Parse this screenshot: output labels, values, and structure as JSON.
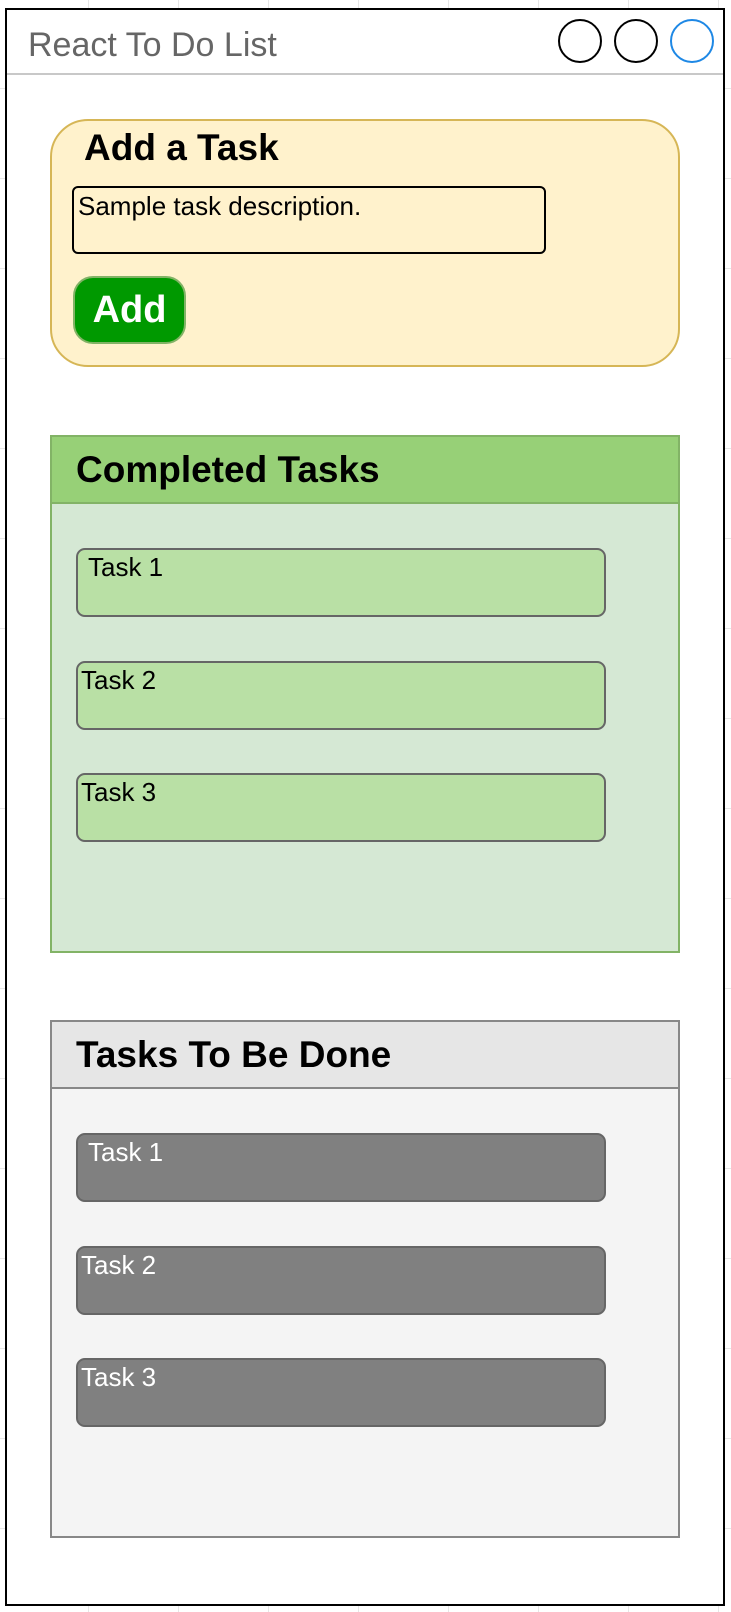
{
  "window": {
    "title": "React To Do List",
    "controls": [
      {
        "name": "window-control-1",
        "color": "#000000"
      },
      {
        "name": "window-control-2",
        "color": "#000000"
      },
      {
        "name": "window-control-3",
        "color": "#1e88e5"
      }
    ]
  },
  "add_task": {
    "heading": "Add a Task",
    "input_value": "Sample task description.",
    "button_label": "Add",
    "colors": {
      "panel": "#fff2cc",
      "panel_border": "#d6b656",
      "button": "#009900"
    }
  },
  "completed": {
    "heading": "Completed Tasks",
    "tasks": [
      {
        "label": "Task 1"
      },
      {
        "label": "Task 2"
      },
      {
        "label": "Task 3"
      }
    ],
    "colors": {
      "header": "#97d077",
      "body": "#d5e8d4",
      "card": "#b9e0a5"
    }
  },
  "todo": {
    "heading": "Tasks To Be Done",
    "tasks": [
      {
        "label": "Task 1"
      },
      {
        "label": "Task 2"
      },
      {
        "label": "Task 3"
      }
    ],
    "colors": {
      "header": "#e6e6e6",
      "body": "#f4f4f4",
      "card": "#808080"
    }
  }
}
